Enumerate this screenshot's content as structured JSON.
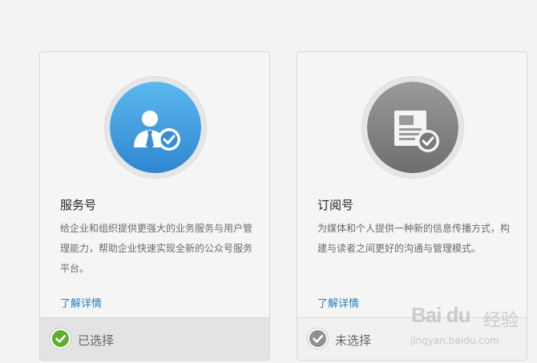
{
  "cards": [
    {
      "title": "服务号",
      "description": "给企业和组织提供更强大的业务服务与用户管理能力，帮助企业快速实现全新的公众号服务平台。",
      "link_label": "了解详情",
      "status_label": "已选择",
      "selected": true,
      "icon": "service-account-icon",
      "accent_color": "#3f9fe0"
    },
    {
      "title": "订阅号",
      "description": "为媒体和个人提供一种新的信息传播方式，构建与读者之间更好的沟通与管理模式。",
      "link_label": "了解详情",
      "status_label": "未选择",
      "selected": false,
      "icon": "subscription-account-icon",
      "accent_color": "#8a8a8a"
    }
  ],
  "watermark": {
    "logo": "Bai du",
    "brand": "经验",
    "url": "jingyan.baidu.com"
  },
  "colors": {
    "link": "#2a7fbd",
    "check_selected": "#5fae2e",
    "check_unselected": "#8f8f8f"
  }
}
